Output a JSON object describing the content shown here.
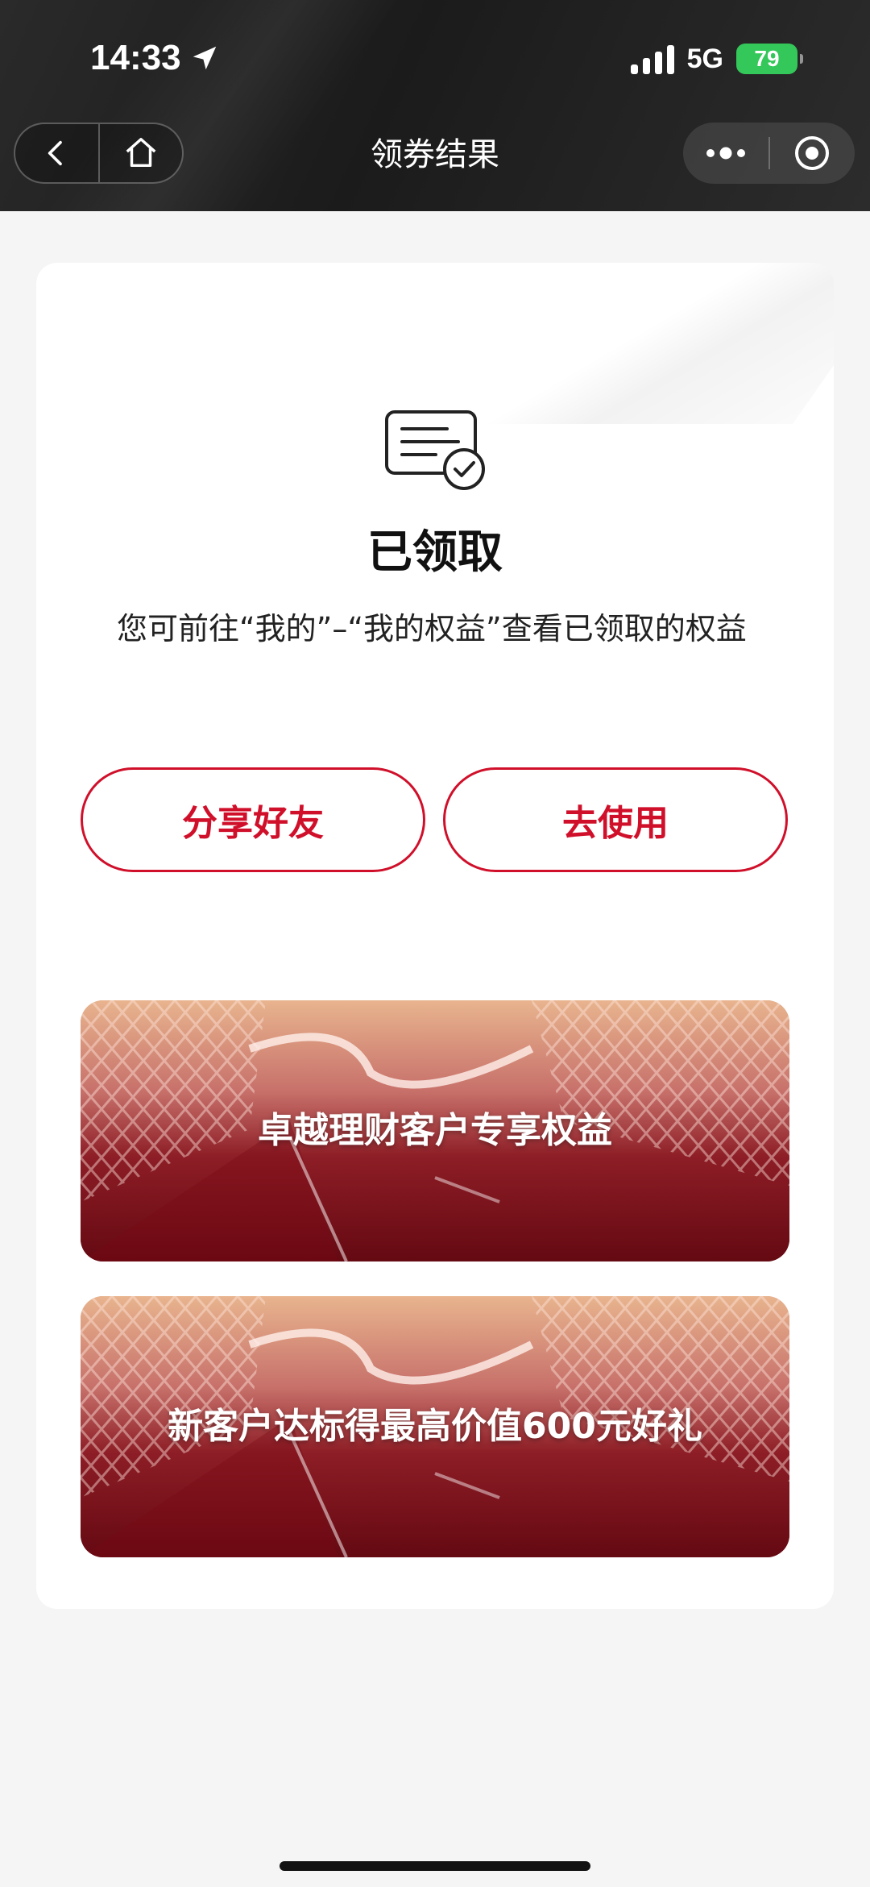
{
  "status_bar": {
    "time": "14:33",
    "network": "5G",
    "battery": "79"
  },
  "nav": {
    "title": "领券结果"
  },
  "result": {
    "title": "已领取",
    "description": "您可前往“我的”–“我的权益”查看已领取的权益"
  },
  "buttons": {
    "share_label": "分享好友",
    "use_label": "去使用"
  },
  "banners": [
    {
      "label": "卓越理财客户专享权益"
    },
    {
      "label": "新客户达标得最高价值600元好礼"
    }
  ],
  "colors": {
    "accent": "#d0102a",
    "header_bg": "#222222",
    "battery": "#34c759"
  },
  "icons": {
    "back": "chevron-left-icon",
    "home": "home-icon",
    "more": "more-dots-icon",
    "close": "target-close-icon",
    "result": "document-check-icon",
    "location": "location-arrow-icon"
  }
}
